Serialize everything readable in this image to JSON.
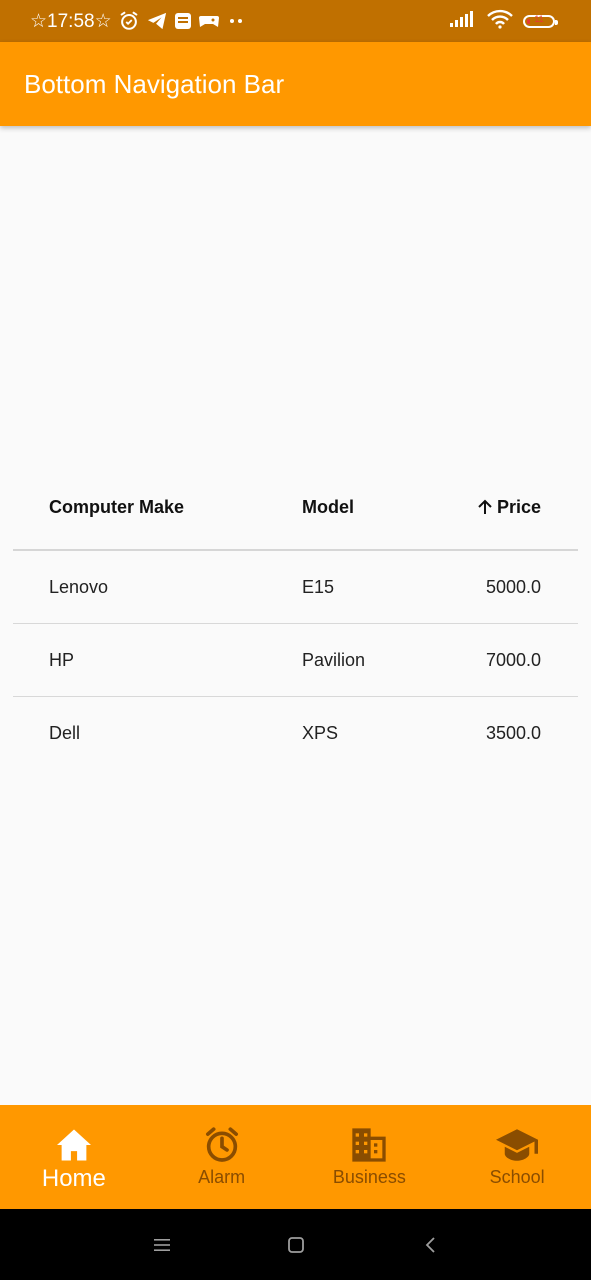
{
  "status_bar": {
    "time": "☆17:58☆",
    "battery_level": "11"
  },
  "app_bar": {
    "title": "Bottom Navigation Bar"
  },
  "table": {
    "columns": {
      "make": "Computer Make",
      "model": "Model",
      "price": "Price"
    },
    "sort_column": "price",
    "sort_direction": "ascending",
    "rows": [
      {
        "make": "Lenovo",
        "model": "E15",
        "price": "5000.0"
      },
      {
        "make": "HP",
        "model": "Pavilion",
        "price": "7000.0"
      },
      {
        "make": "Dell",
        "model": "XPS",
        "price": "3500.0"
      }
    ]
  },
  "bottom_nav": {
    "active_index": 0,
    "items": [
      {
        "label": "Home",
        "icon": "home-icon"
      },
      {
        "label": "Alarm",
        "icon": "alarm-icon"
      },
      {
        "label": "Business",
        "icon": "business-icon"
      },
      {
        "label": "School",
        "icon": "school-icon"
      }
    ]
  },
  "colors": {
    "status_bar": "#c07000",
    "app_bar": "#ff9800",
    "nav_active": "#ffffff",
    "nav_inactive": "#8a4d00",
    "background": "#fafafa"
  },
  "system_nav": {
    "buttons": [
      "menu-icon",
      "home-square-icon",
      "back-icon"
    ]
  }
}
